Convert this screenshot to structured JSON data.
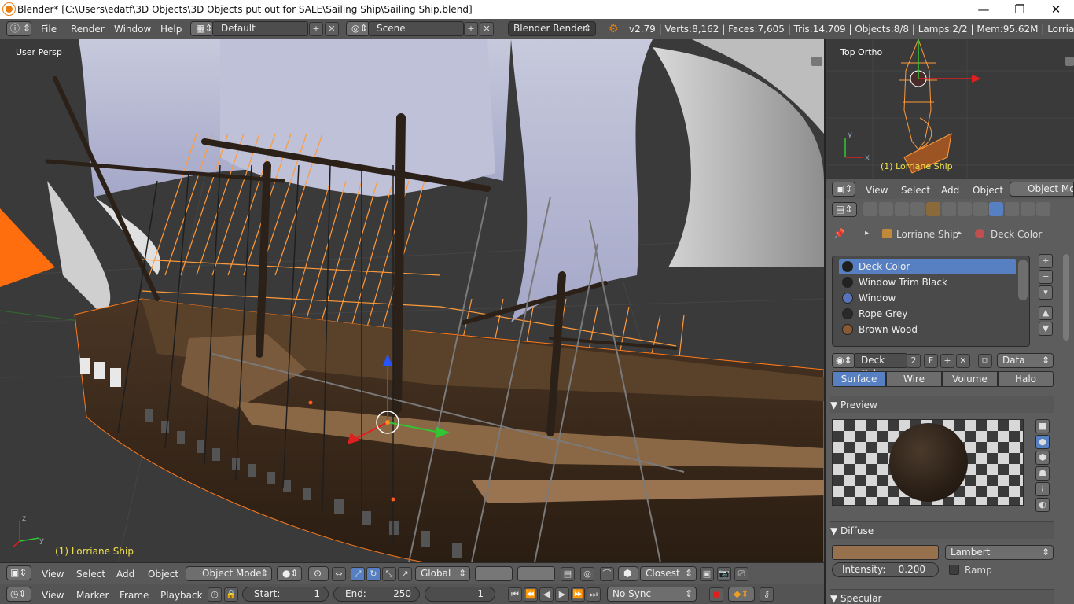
{
  "window": {
    "title": "Blender* [C:\\Users\\edatf\\3D Objects\\3D Objects put out for SALE\\Sailing Ship\\Sailing Ship.blend]",
    "minimize": "—",
    "maximize": "❐",
    "close": "✕"
  },
  "info_header": {
    "menus": [
      "File",
      "Render",
      "Window",
      "Help"
    ],
    "layout": "Default",
    "scene": "Scene",
    "engine": "Blender Render",
    "stats": "v2.79 | Verts:8,162 | Faces:7,605 | Tris:14,709 | Objects:8/8 | Lamps:2/2 | Mem:95.62M | Lorriane Ship"
  },
  "viewport": {
    "view_label": "User Persp",
    "object_label": "(1) Lorriane Ship"
  },
  "view3d_header": {
    "menus": [
      "View",
      "Select",
      "Add",
      "Object"
    ],
    "mode": "Object Mode",
    "orientation": "Global",
    "snap_target": "Closest"
  },
  "timeline": {
    "menus": [
      "View",
      "Marker",
      "Frame",
      "Playback"
    ],
    "start_label": "Start:",
    "start_value": "1",
    "end_label": "End:",
    "end_value": "250",
    "current_frame": "1",
    "sync": "No Sync"
  },
  "top_view": {
    "view_label": "Top Ortho",
    "object_label": "(1) Lorriane Ship",
    "menus": [
      "View",
      "Select",
      "Add",
      "Object"
    ],
    "mode": "Object Mode"
  },
  "properties": {
    "breadcrumb_object": "Lorriane Ship",
    "breadcrumb_material": "Deck Color",
    "materials": [
      {
        "name": "Deck Color",
        "color": "#1f1f1f",
        "selected": true
      },
      {
        "name": "Window Trim Black",
        "color": "#222222",
        "selected": false
      },
      {
        "name": "Window",
        "color": "#5a72b8",
        "selected": false
      },
      {
        "name": "Rope Grey",
        "color": "#2a2a2a",
        "selected": false
      },
      {
        "name": "Brown Wood",
        "color": "#8a5a34",
        "selected": false
      }
    ],
    "material_name": "Deck Color",
    "users": "2",
    "fake_user": "F",
    "link": "Data",
    "tabs": [
      "Surface",
      "Wire",
      "Volume",
      "Halo"
    ],
    "active_tab": "Surface",
    "preview_label": "Preview",
    "diffuse_label": "Diffuse",
    "diffuse_color": "#97714e",
    "diffuse_shader": "Lambert",
    "intensity_label": "Intensity:",
    "intensity_value": "0.200",
    "ramp_label": "Ramp",
    "specular_label": "Specular"
  },
  "colors": {
    "selection": "#ff8a1f",
    "active_text": "#f0e14a",
    "highlight": "#5680c2"
  }
}
